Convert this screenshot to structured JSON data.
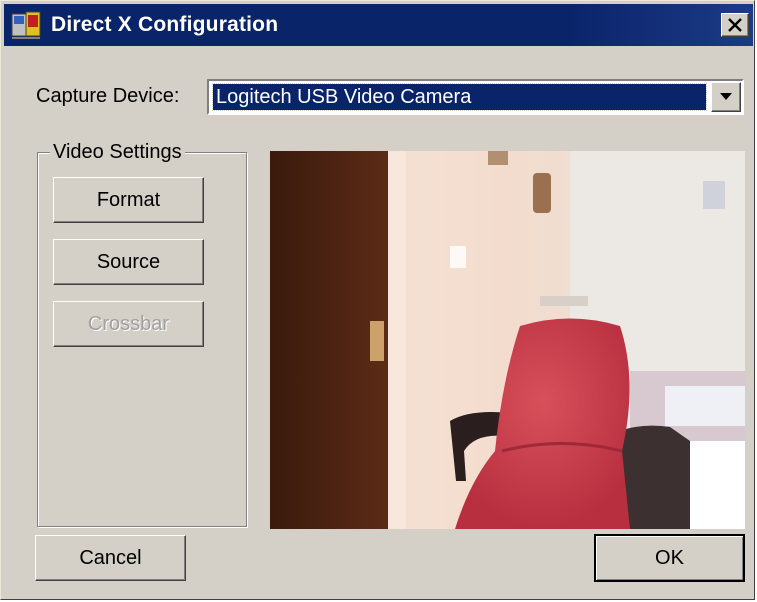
{
  "window": {
    "title": "Direct X Configuration",
    "close_icon": "close-icon"
  },
  "capture": {
    "label": "Capture Device:",
    "selected": "Logitech USB Video Camera"
  },
  "video_settings": {
    "legend": "Video Settings",
    "format_label": "Format",
    "source_label": "Source",
    "crossbar_label": "Crossbar",
    "crossbar_enabled": false
  },
  "footer": {
    "cancel_label": "Cancel",
    "ok_label": "OK"
  },
  "colors": {
    "titlebar": "#0a246a",
    "face": "#d4d0c8",
    "selection": "#0a246a"
  },
  "preview": {
    "content": "webcam-preview-image"
  }
}
